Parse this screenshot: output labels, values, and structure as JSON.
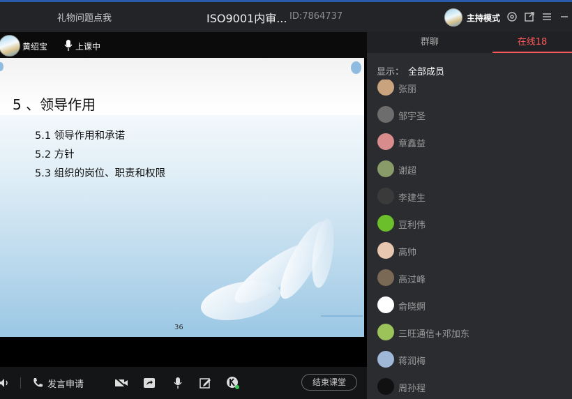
{
  "titlebar": {
    "gift_link": "礼物问题点我",
    "course_title": "ISO9001内审...",
    "room_id": "ID:7864737",
    "mode_label": "主持模式"
  },
  "teacher": {
    "name": "黄绍宝",
    "status": "上课中"
  },
  "slide": {
    "title": "5 、领导作用",
    "items": [
      "5.1  领导作用和承诺",
      "5.2  方针",
      "5.3  组织的岗位、职责和权限"
    ],
    "page_number": "36"
  },
  "controls": {
    "apply_speak": "发言申请",
    "end_class": "结束课堂"
  },
  "panel": {
    "tab_chat": "群聊",
    "tab_online": "在线18",
    "filter_label": "显示：",
    "filter_value": "全部成员"
  },
  "members": [
    {
      "name": "张丽",
      "avatar": "#c9a27e"
    },
    {
      "name": "邹宇圣",
      "avatar": "#6d6d6d"
    },
    {
      "name": "章鑫益",
      "avatar": "#d98c8c"
    },
    {
      "name": "谢超",
      "avatar": "#8a9b6a"
    },
    {
      "name": "李建生",
      "avatar": "#3a3a3a"
    },
    {
      "name": "豆利伟",
      "avatar": "#6bbf2a"
    },
    {
      "name": "高帅",
      "avatar": "#e8c7b0"
    },
    {
      "name": "高过峰",
      "avatar": "#7a6a55"
    },
    {
      "name": "俞晓婀",
      "avatar": "#ffffff"
    },
    {
      "name": "三旺通信+邓加东",
      "avatar": "#9cc35a"
    },
    {
      "name": "蒋润梅",
      "avatar": "#9fb8d8"
    },
    {
      "name": "周孙程",
      "avatar": "#111111"
    }
  ],
  "colors": {
    "accent_online": "#ff5a5a",
    "titlebar_bg": "#232428",
    "panel_bg": "#2b2c30"
  }
}
